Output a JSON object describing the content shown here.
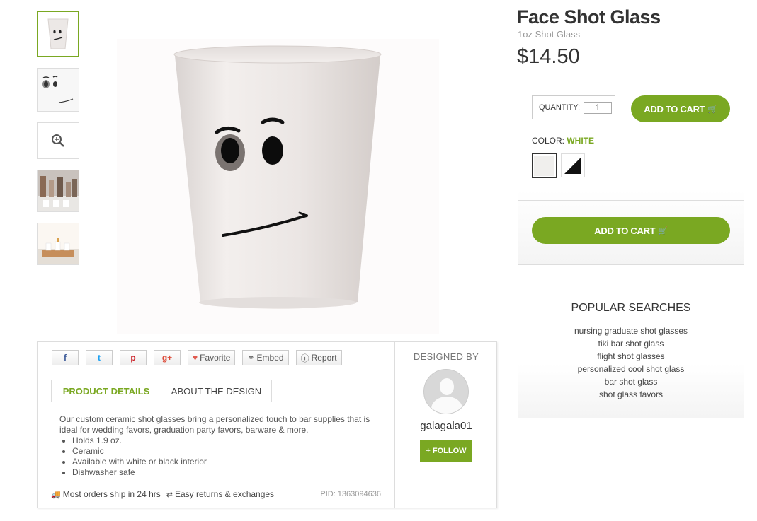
{
  "product": {
    "title": "Face Shot Glass",
    "subtitle": "1oz Shot Glass",
    "price": "$14.50"
  },
  "gallery": {
    "thumbnails": [
      "thumb-face-glass",
      "thumb-face-closeup",
      "zoom-icon",
      "thumb-lifestyle-bar",
      "thumb-lifestyle-table"
    ],
    "zoom_glyph": "⚲"
  },
  "share": {
    "facebook": "f",
    "twitter": "t",
    "pinterest": "p",
    "googleplus": "g+",
    "favorite": "Favorite",
    "embed": "Embed",
    "report": "Report"
  },
  "tabs": {
    "product_details": "PRODUCT DETAILS",
    "about_design": "ABOUT THE DESIGN"
  },
  "description": {
    "intro": "Our custom ceramic shot glasses bring a personalized touch to bar supplies that is ideal for wedding favors, graduation party favors, barware & more.",
    "bullets": [
      "Holds 1.9 oz.",
      "Ceramic",
      "Available with white or black interior",
      "Dishwasher safe"
    ]
  },
  "footer": {
    "shipping": "Most orders ship in 24 hrs",
    "returns": "Easy returns & exchanges",
    "pid": "PID: 1363094636"
  },
  "designer": {
    "label": "DESIGNED BY",
    "name": "galagala01",
    "follow": "+ FOLLOW"
  },
  "cart": {
    "quantity_label": "QUANTITY:",
    "quantity_value": "1",
    "add_to_cart": "ADD TO CART",
    "color_label": "COLOR:",
    "color_value": "WHITE"
  },
  "popular_searches": {
    "heading": "POPULAR SEARCHES",
    "items": [
      "nursing graduate shot glasses",
      "tiki bar shot glass",
      "flight shot glasses",
      "personalized cool shot glass",
      "bar shot glass",
      "shot glass favors"
    ]
  },
  "colors": {
    "accent": "#7aa822"
  }
}
